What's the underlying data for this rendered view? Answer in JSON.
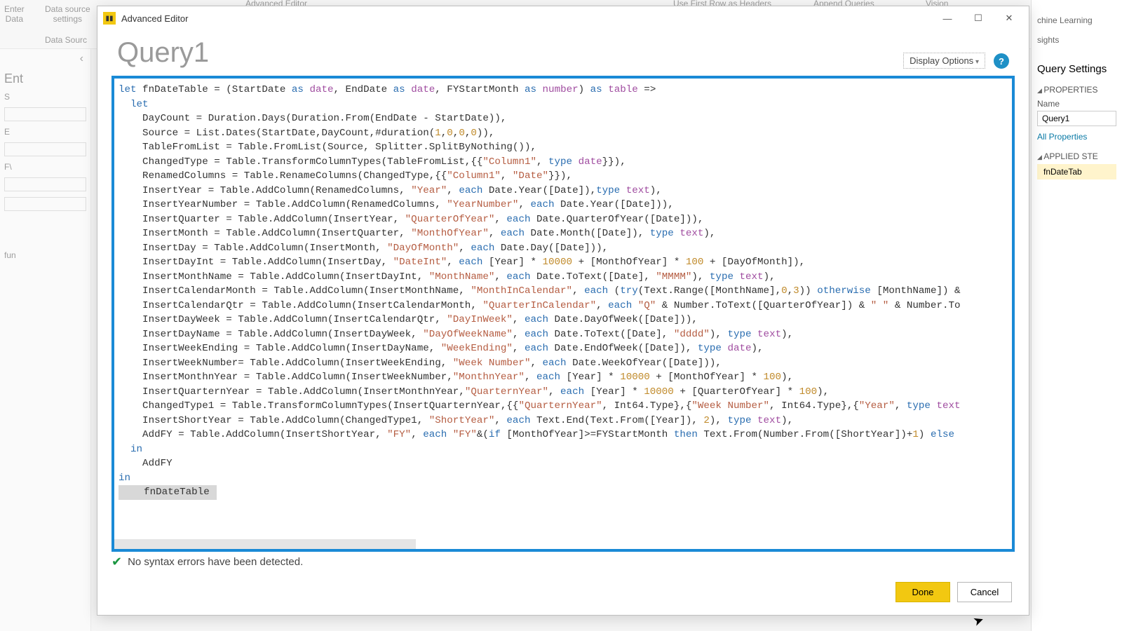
{
  "ribbon": {
    "enter_data": "Enter\nData",
    "data_source": "Data source\nsettings",
    "data_sources": "Data Sourc",
    "adv_editor": "Advanced Editor",
    "first_row": "Use First Row as Headers",
    "append": "Append Queries",
    "vision": "Vision",
    "ml_group": "chine Learning",
    "insights": "sights"
  },
  "left": {
    "chev": "‹",
    "tab_x": "×",
    "ent": "Ent",
    "s": "S",
    "e": "E",
    "fy": "F\\",
    "fun": "fun"
  },
  "right": {
    "title": "Query Settings",
    "props": "PROPERTIES",
    "name_lbl": "Name",
    "name_val": "Query1",
    "all_props": "All Properties",
    "applied": "APPLIED STE",
    "step1": "fnDateTab"
  },
  "ae": {
    "title": "Advanced Editor",
    "query_name": "Query1",
    "display_opts": "Display Options",
    "status": "No syntax errors have been detected.",
    "done": "Done",
    "cancel": "Cancel"
  },
  "code_tokens": [
    [
      [
        "kw",
        "let"
      ],
      [
        "",
        " fnDateTable = (StartDate "
      ],
      [
        "kw",
        "as"
      ],
      [
        "",
        " "
      ],
      [
        "ty",
        "date"
      ],
      [
        "",
        ", EndDate "
      ],
      [
        "kw",
        "as"
      ],
      [
        "",
        " "
      ],
      [
        "ty",
        "date"
      ],
      [
        "",
        ", FYStartMonth "
      ],
      [
        "kw",
        "as"
      ],
      [
        "",
        " "
      ],
      [
        "ty",
        "number"
      ],
      [
        "",
        ") "
      ],
      [
        "kw",
        "as"
      ],
      [
        "",
        " "
      ],
      [
        "ty",
        "table"
      ],
      [
        "",
        " =>"
      ]
    ],
    [
      [
        "",
        "  "
      ],
      [
        "kw",
        "let"
      ]
    ],
    [
      [
        "",
        "    DayCount = Duration.Days(Duration.From(EndDate - StartDate)),"
      ]
    ],
    [
      [
        "",
        "    Source = List.Dates(StartDate,DayCount,#duration("
      ],
      [
        "num",
        "1"
      ],
      [
        "",
        ","
      ],
      [
        "num",
        "0"
      ],
      [
        "",
        ","
      ],
      [
        "num",
        "0"
      ],
      [
        "",
        ","
      ],
      [
        "num",
        "0"
      ],
      [
        "",
        ")),"
      ]
    ],
    [
      [
        "",
        "    TableFromList = Table.FromList(Source, Splitter.SplitByNothing()),"
      ]
    ],
    [
      [
        "",
        "    ChangedType = Table.TransformColumnTypes(TableFromList,{{"
      ],
      [
        "str",
        "\"Column1\""
      ],
      [
        "",
        ", "
      ],
      [
        "kw",
        "type"
      ],
      [
        "",
        " "
      ],
      [
        "ty",
        "date"
      ],
      [
        "",
        "}}),"
      ]
    ],
    [
      [
        "",
        "    RenamedColumns = Table.RenameColumns(ChangedType,{{"
      ],
      [
        "str",
        "\"Column1\""
      ],
      [
        "",
        ", "
      ],
      [
        "str",
        "\"Date\""
      ],
      [
        "",
        "}}),"
      ]
    ],
    [
      [
        "",
        "    InsertYear = Table.AddColumn(RenamedColumns, "
      ],
      [
        "str",
        "\"Year\""
      ],
      [
        "",
        ", "
      ],
      [
        "kw",
        "each"
      ],
      [
        "",
        " Date.Year([Date]),"
      ],
      [
        "kw",
        "type"
      ],
      [
        "",
        " "
      ],
      [
        "ty",
        "text"
      ],
      [
        "",
        "),"
      ]
    ],
    [
      [
        "",
        "    InsertYearNumber = Table.AddColumn(RenamedColumns, "
      ],
      [
        "str",
        "\"YearNumber\""
      ],
      [
        "",
        ", "
      ],
      [
        "kw",
        "each"
      ],
      [
        "",
        " Date.Year([Date])),"
      ]
    ],
    [
      [
        "",
        "    InsertQuarter = Table.AddColumn(InsertYear, "
      ],
      [
        "str",
        "\"QuarterOfYear\""
      ],
      [
        "",
        ", "
      ],
      [
        "kw",
        "each"
      ],
      [
        "",
        " Date.QuarterOfYear([Date])),"
      ]
    ],
    [
      [
        "",
        "    InsertMonth = Table.AddColumn(InsertQuarter, "
      ],
      [
        "str",
        "\"MonthOfYear\""
      ],
      [
        "",
        ", "
      ],
      [
        "kw",
        "each"
      ],
      [
        "",
        " Date.Month([Date]), "
      ],
      [
        "kw",
        "type"
      ],
      [
        "",
        " "
      ],
      [
        "ty",
        "text"
      ],
      [
        "",
        "),"
      ]
    ],
    [
      [
        "",
        "    InsertDay = Table.AddColumn(InsertMonth, "
      ],
      [
        "str",
        "\"DayOfMonth\""
      ],
      [
        "",
        ", "
      ],
      [
        "kw",
        "each"
      ],
      [
        "",
        " Date.Day([Date])),"
      ]
    ],
    [
      [
        "",
        "    InsertDayInt = Table.AddColumn(InsertDay, "
      ],
      [
        "str",
        "\"DateInt\""
      ],
      [
        "",
        ", "
      ],
      [
        "kw",
        "each"
      ],
      [
        "",
        " [Year] * "
      ],
      [
        "num",
        "10000"
      ],
      [
        "",
        " + [MonthOfYear] * "
      ],
      [
        "num",
        "100"
      ],
      [
        "",
        " + [DayOfMonth]),"
      ]
    ],
    [
      [
        "",
        "    InsertMonthName = Table.AddColumn(InsertDayInt, "
      ],
      [
        "str",
        "\"MonthName\""
      ],
      [
        "",
        ", "
      ],
      [
        "kw",
        "each"
      ],
      [
        "",
        " Date.ToText([Date], "
      ],
      [
        "str",
        "\"MMMM\""
      ],
      [
        "",
        "), "
      ],
      [
        "kw",
        "type"
      ],
      [
        "",
        " "
      ],
      [
        "ty",
        "text"
      ],
      [
        "",
        "),"
      ]
    ],
    [
      [
        "",
        "    InsertCalendarMonth = Table.AddColumn(InsertMonthName, "
      ],
      [
        "str",
        "\"MonthInCalendar\""
      ],
      [
        "",
        ", "
      ],
      [
        "kw",
        "each"
      ],
      [
        "",
        " ("
      ],
      [
        "kw",
        "try"
      ],
      [
        "",
        "(Text.Range([MonthName],"
      ],
      [
        "num",
        "0"
      ],
      [
        "",
        ","
      ],
      [
        "num",
        "3"
      ],
      [
        "",
        ")) "
      ],
      [
        "kw",
        "otherwise"
      ],
      [
        "",
        " [MonthName]) &"
      ]
    ],
    [
      [
        "",
        "    InsertCalendarQtr = Table.AddColumn(InsertCalendarMonth, "
      ],
      [
        "str",
        "\"QuarterInCalendar\""
      ],
      [
        "",
        ", "
      ],
      [
        "kw",
        "each"
      ],
      [
        "",
        " "
      ],
      [
        "str",
        "\"Q\""
      ],
      [
        "",
        " & Number.ToText([QuarterOfYear]) & "
      ],
      [
        "str",
        "\" \""
      ],
      [
        "",
        " & Number.To"
      ]
    ],
    [
      [
        "",
        "    InsertDayWeek = Table.AddColumn(InsertCalendarQtr, "
      ],
      [
        "str",
        "\"DayInWeek\""
      ],
      [
        "",
        ", "
      ],
      [
        "kw",
        "each"
      ],
      [
        "",
        " Date.DayOfWeek([Date])),"
      ]
    ],
    [
      [
        "",
        "    InsertDayName = Table.AddColumn(InsertDayWeek, "
      ],
      [
        "str",
        "\"DayOfWeekName\""
      ],
      [
        "",
        ", "
      ],
      [
        "kw",
        "each"
      ],
      [
        "",
        " Date.ToText([Date], "
      ],
      [
        "str",
        "\"dddd\""
      ],
      [
        "",
        "), "
      ],
      [
        "kw",
        "type"
      ],
      [
        "",
        " "
      ],
      [
        "ty",
        "text"
      ],
      [
        "",
        "),"
      ]
    ],
    [
      [
        "",
        "    InsertWeekEnding = Table.AddColumn(InsertDayName, "
      ],
      [
        "str",
        "\"WeekEnding\""
      ],
      [
        "",
        ", "
      ],
      [
        "kw",
        "each"
      ],
      [
        "",
        " Date.EndOfWeek([Date]), "
      ],
      [
        "kw",
        "type"
      ],
      [
        "",
        " "
      ],
      [
        "ty",
        "date"
      ],
      [
        "",
        "),"
      ]
    ],
    [
      [
        "",
        "    InsertWeekNumber= Table.AddColumn(InsertWeekEnding, "
      ],
      [
        "str",
        "\"Week Number\""
      ],
      [
        "",
        ", "
      ],
      [
        "kw",
        "each"
      ],
      [
        "",
        " Date.WeekOfYear([Date])),"
      ]
    ],
    [
      [
        "",
        "    InsertMonthnYear = Table.AddColumn(InsertWeekNumber,"
      ],
      [
        "str",
        "\"MonthnYear\""
      ],
      [
        "",
        ", "
      ],
      [
        "kw",
        "each"
      ],
      [
        "",
        " [Year] * "
      ],
      [
        "num",
        "10000"
      ],
      [
        "",
        " + [MonthOfYear] * "
      ],
      [
        "num",
        "100"
      ],
      [
        "",
        "),"
      ]
    ],
    [
      [
        "",
        "    InsertQuarternYear = Table.AddColumn(InsertMonthnYear,"
      ],
      [
        "str",
        "\"QuarternYear\""
      ],
      [
        "",
        ", "
      ],
      [
        "kw",
        "each"
      ],
      [
        "",
        " [Year] * "
      ],
      [
        "num",
        "10000"
      ],
      [
        "",
        " + [QuarterOfYear] * "
      ],
      [
        "num",
        "100"
      ],
      [
        "",
        "),"
      ]
    ],
    [
      [
        "",
        "    ChangedType1 = Table.TransformColumnTypes(InsertQuarternYear,{{"
      ],
      [
        "str",
        "\"QuarternYear\""
      ],
      [
        "",
        ", Int64.Type},{"
      ],
      [
        "str",
        "\"Week Number\""
      ],
      [
        "",
        ", Int64.Type},{"
      ],
      [
        "str",
        "\"Year\""
      ],
      [
        "",
        ", "
      ],
      [
        "kw",
        "type"
      ],
      [
        "",
        " "
      ],
      [
        "ty",
        "text"
      ]
    ],
    [
      [
        "",
        "    InsertShortYear = Table.AddColumn(ChangedType1, "
      ],
      [
        "str",
        "\"ShortYear\""
      ],
      [
        "",
        ", "
      ],
      [
        "kw",
        "each"
      ],
      [
        "",
        " Text.End(Text.From([Year]), "
      ],
      [
        "num",
        "2"
      ],
      [
        "",
        "), "
      ],
      [
        "kw",
        "type"
      ],
      [
        "",
        " "
      ],
      [
        "ty",
        "text"
      ],
      [
        "",
        "),"
      ]
    ],
    [
      [
        "",
        "    AddFY = Table.AddColumn(InsertShortYear, "
      ],
      [
        "str",
        "\"FY\""
      ],
      [
        "",
        ", "
      ],
      [
        "kw",
        "each"
      ],
      [
        "",
        " "
      ],
      [
        "str",
        "\"FY\""
      ],
      [
        "",
        "&("
      ],
      [
        "kw",
        "if"
      ],
      [
        "",
        " [MonthOfYear]>=FYStartMonth "
      ],
      [
        "kw",
        "then"
      ],
      [
        "",
        " Text.From(Number.From([ShortYear])+"
      ],
      [
        "num",
        "1"
      ],
      [
        "",
        ") "
      ],
      [
        "kw",
        "else"
      ]
    ],
    [
      [
        "",
        "  "
      ],
      [
        "kw",
        "in"
      ]
    ],
    [
      [
        "",
        "    AddFY"
      ]
    ],
    [
      [
        "",
        ""
      ],
      [
        "kw",
        "in"
      ]
    ],
    [
      [
        "sel",
        "    fnDateTable"
      ]
    ]
  ]
}
